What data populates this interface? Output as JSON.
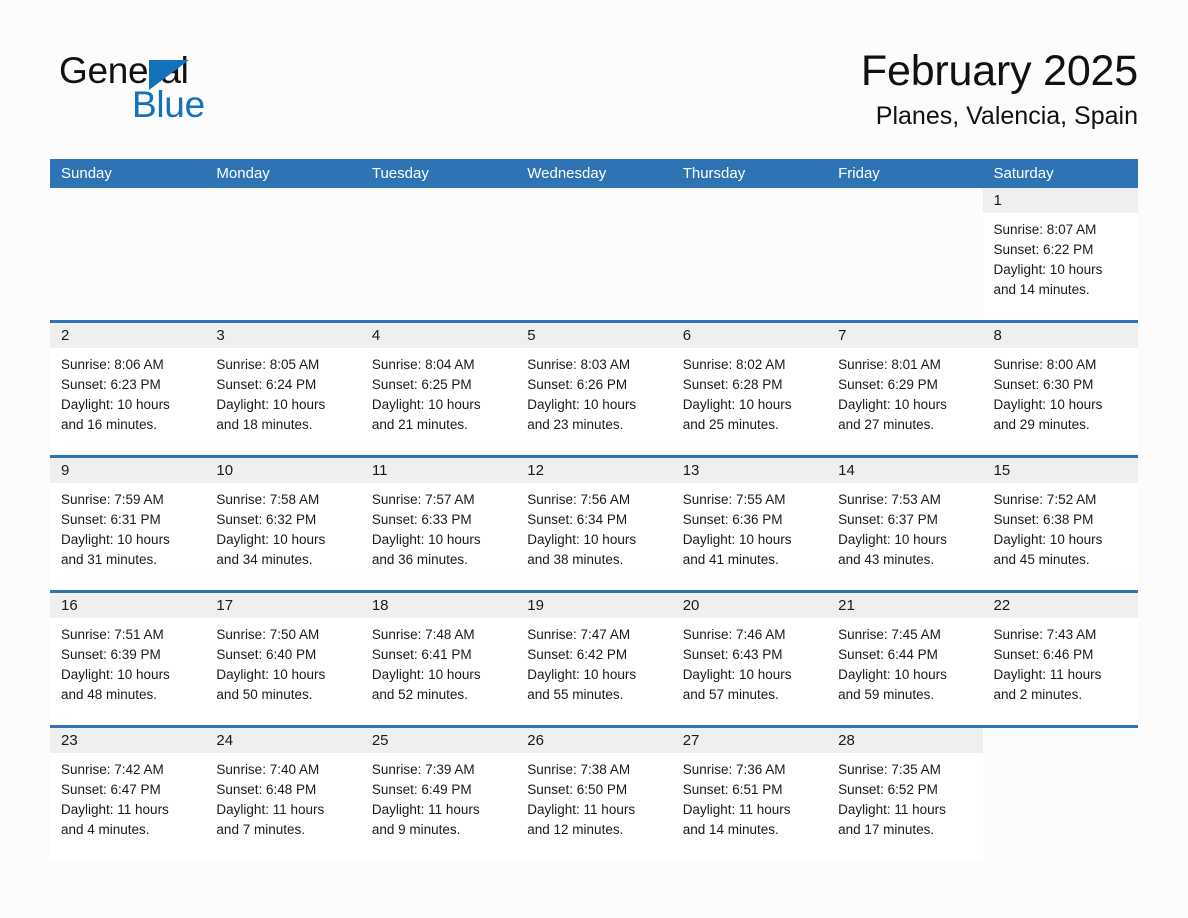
{
  "brand": {
    "name_part1": "General",
    "name_part2": "Blue",
    "accent_color": "#1272BC"
  },
  "header": {
    "month_title": "February 2025",
    "location": "Planes, Valencia, Spain"
  },
  "theme": {
    "header_blue": "#2E74B5",
    "daynum_band": "#EFEFEF",
    "text": "#1A1A1A",
    "page_background": "#FCFCFC"
  },
  "weekdays": [
    "Sunday",
    "Monday",
    "Tuesday",
    "Wednesday",
    "Thursday",
    "Friday",
    "Saturday"
  ],
  "labels": {
    "sunrise_prefix": "Sunrise:",
    "sunset_prefix": "Sunset:",
    "daylight_prefix": "Daylight:"
  },
  "weeks": [
    [
      {
        "day": "",
        "blank": true
      },
      {
        "day": "",
        "blank": true
      },
      {
        "day": "",
        "blank": true
      },
      {
        "day": "",
        "blank": true
      },
      {
        "day": "",
        "blank": true
      },
      {
        "day": "",
        "blank": true
      },
      {
        "day": "1",
        "sunrise": "Sunrise: 8:07 AM",
        "sunset": "Sunset: 6:22 PM",
        "daylight": "Daylight: 10 hours and 14 minutes."
      }
    ],
    [
      {
        "day": "2",
        "sunrise": "Sunrise: 8:06 AM",
        "sunset": "Sunset: 6:23 PM",
        "daylight": "Daylight: 10 hours and 16 minutes."
      },
      {
        "day": "3",
        "sunrise": "Sunrise: 8:05 AM",
        "sunset": "Sunset: 6:24 PM",
        "daylight": "Daylight: 10 hours and 18 minutes."
      },
      {
        "day": "4",
        "sunrise": "Sunrise: 8:04 AM",
        "sunset": "Sunset: 6:25 PM",
        "daylight": "Daylight: 10 hours and 21 minutes."
      },
      {
        "day": "5",
        "sunrise": "Sunrise: 8:03 AM",
        "sunset": "Sunset: 6:26 PM",
        "daylight": "Daylight: 10 hours and 23 minutes."
      },
      {
        "day": "6",
        "sunrise": "Sunrise: 8:02 AM",
        "sunset": "Sunset: 6:28 PM",
        "daylight": "Daylight: 10 hours and 25 minutes."
      },
      {
        "day": "7",
        "sunrise": "Sunrise: 8:01 AM",
        "sunset": "Sunset: 6:29 PM",
        "daylight": "Daylight: 10 hours and 27 minutes."
      },
      {
        "day": "8",
        "sunrise": "Sunrise: 8:00 AM",
        "sunset": "Sunset: 6:30 PM",
        "daylight": "Daylight: 10 hours and 29 minutes."
      }
    ],
    [
      {
        "day": "9",
        "sunrise": "Sunrise: 7:59 AM",
        "sunset": "Sunset: 6:31 PM",
        "daylight": "Daylight: 10 hours and 31 minutes."
      },
      {
        "day": "10",
        "sunrise": "Sunrise: 7:58 AM",
        "sunset": "Sunset: 6:32 PM",
        "daylight": "Daylight: 10 hours and 34 minutes."
      },
      {
        "day": "11",
        "sunrise": "Sunrise: 7:57 AM",
        "sunset": "Sunset: 6:33 PM",
        "daylight": "Daylight: 10 hours and 36 minutes."
      },
      {
        "day": "12",
        "sunrise": "Sunrise: 7:56 AM",
        "sunset": "Sunset: 6:34 PM",
        "daylight": "Daylight: 10 hours and 38 minutes."
      },
      {
        "day": "13",
        "sunrise": "Sunrise: 7:55 AM",
        "sunset": "Sunset: 6:36 PM",
        "daylight": "Daylight: 10 hours and 41 minutes."
      },
      {
        "day": "14",
        "sunrise": "Sunrise: 7:53 AM",
        "sunset": "Sunset: 6:37 PM",
        "daylight": "Daylight: 10 hours and 43 minutes."
      },
      {
        "day": "15",
        "sunrise": "Sunrise: 7:52 AM",
        "sunset": "Sunset: 6:38 PM",
        "daylight": "Daylight: 10 hours and 45 minutes."
      }
    ],
    [
      {
        "day": "16",
        "sunrise": "Sunrise: 7:51 AM",
        "sunset": "Sunset: 6:39 PM",
        "daylight": "Daylight: 10 hours and 48 minutes."
      },
      {
        "day": "17",
        "sunrise": "Sunrise: 7:50 AM",
        "sunset": "Sunset: 6:40 PM",
        "daylight": "Daylight: 10 hours and 50 minutes."
      },
      {
        "day": "18",
        "sunrise": "Sunrise: 7:48 AM",
        "sunset": "Sunset: 6:41 PM",
        "daylight": "Daylight: 10 hours and 52 minutes."
      },
      {
        "day": "19",
        "sunrise": "Sunrise: 7:47 AM",
        "sunset": "Sunset: 6:42 PM",
        "daylight": "Daylight: 10 hours and 55 minutes."
      },
      {
        "day": "20",
        "sunrise": "Sunrise: 7:46 AM",
        "sunset": "Sunset: 6:43 PM",
        "daylight": "Daylight: 10 hours and 57 minutes."
      },
      {
        "day": "21",
        "sunrise": "Sunrise: 7:45 AM",
        "sunset": "Sunset: 6:44 PM",
        "daylight": "Daylight: 10 hours and 59 minutes."
      },
      {
        "day": "22",
        "sunrise": "Sunrise: 7:43 AM",
        "sunset": "Sunset: 6:46 PM",
        "daylight": "Daylight: 11 hours and 2 minutes."
      }
    ],
    [
      {
        "day": "23",
        "sunrise": "Sunrise: 7:42 AM",
        "sunset": "Sunset: 6:47 PM",
        "daylight": "Daylight: 11 hours and 4 minutes."
      },
      {
        "day": "24",
        "sunrise": "Sunrise: 7:40 AM",
        "sunset": "Sunset: 6:48 PM",
        "daylight": "Daylight: 11 hours and 7 minutes."
      },
      {
        "day": "25",
        "sunrise": "Sunrise: 7:39 AM",
        "sunset": "Sunset: 6:49 PM",
        "daylight": "Daylight: 11 hours and 9 minutes."
      },
      {
        "day": "26",
        "sunrise": "Sunrise: 7:38 AM",
        "sunset": "Sunset: 6:50 PM",
        "daylight": "Daylight: 11 hours and 12 minutes."
      },
      {
        "day": "27",
        "sunrise": "Sunrise: 7:36 AM",
        "sunset": "Sunset: 6:51 PM",
        "daylight": "Daylight: 11 hours and 14 minutes."
      },
      {
        "day": "28",
        "sunrise": "Sunrise: 7:35 AM",
        "sunset": "Sunset: 6:52 PM",
        "daylight": "Daylight: 11 hours and 17 minutes."
      },
      {
        "day": "",
        "blank": true
      }
    ]
  ]
}
